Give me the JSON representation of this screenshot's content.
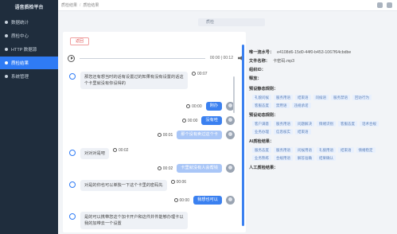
{
  "app": {
    "title": "语音质检平台"
  },
  "sidebar": {
    "items": [
      {
        "label": "数据统计"
      },
      {
        "label": "质检中心"
      },
      {
        "label": "HTTP 数据源"
      },
      {
        "label": "质检结果"
      },
      {
        "label": "系统管理"
      }
    ]
  },
  "breadcrumb": {
    "root": "质检结果",
    "current": "质检结果"
  },
  "tab": {
    "label": "质检"
  },
  "back_label": "返回",
  "player": {
    "time": "00:00 | 00:12"
  },
  "messages": [
    {
      "speaker": "agent",
      "text": "那您还有想当时的话有设置过的知果有没有设置的话这个卡里就没有你设得的",
      "time": "00:07"
    },
    {
      "speaker": "user",
      "text": "刚办",
      "time": "00:00"
    },
    {
      "speaker": "user",
      "text": "没有哇",
      "time": "00:00"
    },
    {
      "speaker": "user",
      "text": "那个没有卖过这个卡",
      "time": "00:01"
    },
    {
      "speaker": "agent",
      "text": "对对对是吧",
      "time": "00:02"
    },
    {
      "speaker": "user",
      "text": "卡里就没有人会帮钱",
      "time": "00:02"
    },
    {
      "speaker": "agent",
      "text": "对是的你也可以单独一下这个卡里的密码先",
      "time": "00:06"
    },
    {
      "speaker": "user",
      "text": "我想也可以",
      "time": "00:00"
    },
    {
      "speaker": "agent",
      "text": "是的可以携带您这个加卡开户和这件并件能够办理卡以我的加带去一个设置",
      "time": ""
    }
  ],
  "info": {
    "id_label": "唯一流水号：",
    "id_value": "e4108d6-15d0-44f0-b453-1067f64cbdbe",
    "file_label": "文件名称：",
    "file_value": "卡密码.mp3",
    "org_label": "组织ID：",
    "speech_label": "释放：",
    "static_rules_label": "预设静态规则：",
    "static_tags": [
      "礼貌问候",
      "服务用语",
      "结束语",
      "问候语",
      "服务禁语",
      "回访行为",
      "客服态度",
      "禁用语",
      "违规承诺"
    ],
    "dynamic_rules_label": "预设动态规则：",
    "dynamic_tags": [
      "客户满意",
      "服务用语",
      "问题解决",
      "情绪识别",
      "客服态度",
      "话术合规",
      "业务办理",
      "信息核实",
      "结束语"
    ],
    "ai_label": "AI质检结果：",
    "ai_tags": [
      "服务态度",
      "服务用语",
      "问候用语",
      "礼貌用语",
      "结束语",
      "情绪稳定",
      "业务熟练",
      "合规用语",
      "解答准确",
      "结果确认"
    ],
    "manual_label": "人工质检结果："
  },
  "colors": {
    "primary": "#2f7bf5",
    "sidebar": "#1f2d3d"
  }
}
